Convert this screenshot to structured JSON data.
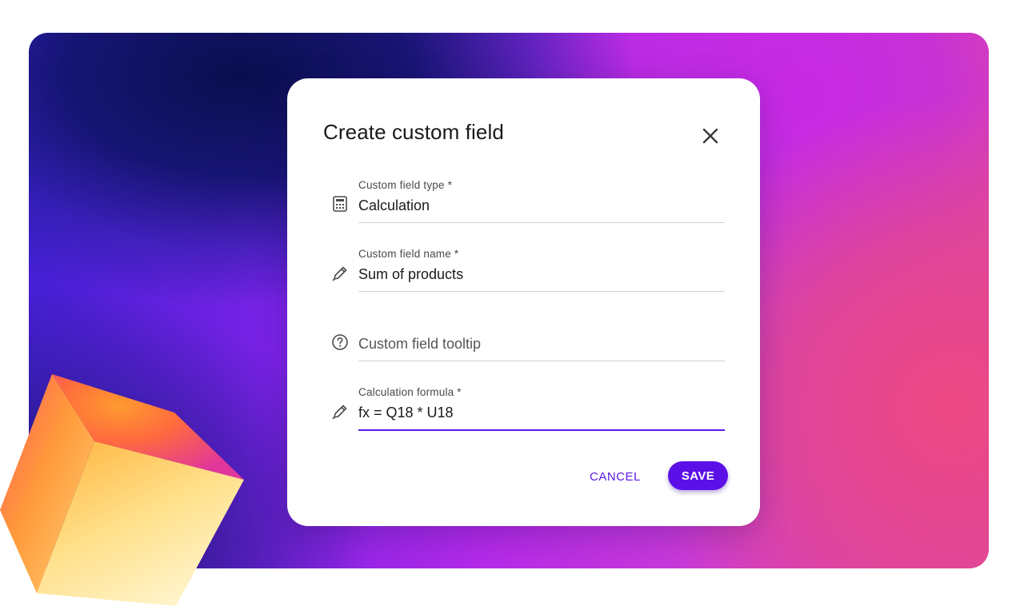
{
  "dialog": {
    "title": "Create custom field",
    "close_icon": "close-icon"
  },
  "fields": {
    "type": {
      "label": "Custom field type *",
      "value": "Calculation",
      "icon": "calculator-icon"
    },
    "name": {
      "label": "Custom field name *",
      "value": "Sum of products",
      "icon": "pencil-icon"
    },
    "tooltip": {
      "label": "",
      "value": "",
      "placeholder": "Custom field tooltip",
      "icon": "help-circle-icon"
    },
    "formula": {
      "label": "Calculation formula *",
      "value": "fx = Q18 * U18",
      "icon": "pencil-icon",
      "focused": true
    }
  },
  "actions": {
    "cancel_label": "CANCEL",
    "save_label": "SAVE"
  },
  "colors": {
    "accent": "#5b10e8",
    "input_underline": "#d4d4d4",
    "text": "#1a1a1a",
    "label": "#4a4a4a"
  }
}
